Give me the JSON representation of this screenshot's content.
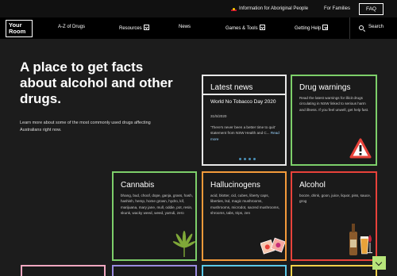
{
  "topbar": {
    "aboriginal_link": "Information for Aboriginal People",
    "families_link": "For Families",
    "faq_label": "FAQ"
  },
  "logo": {
    "line1": "Your",
    "line2": "Room"
  },
  "nav": {
    "az_drugs": "A-Z of Drugs",
    "resources": "Resources",
    "news": "News",
    "games_tools": "Games & Tools",
    "getting_help": "Getting Help",
    "search": "Search"
  },
  "hero": {
    "title": "A place to get facts about alcohol and other drugs.",
    "subtitle": "Learn more about some of the most commonly used drugs affecting Australians right now."
  },
  "cards": {
    "news": {
      "heading": "Latest news",
      "item_title": "World No Tobacco Day 2020",
      "item_date": "31/5/2020",
      "item_body": "'There's never been a better time to quit' statement from NSW Health and C...",
      "read_more": "Read more"
    },
    "warnings": {
      "heading": "Drug warnings",
      "body": "Read the latest warnings for illicit drugs circulating in NSW linked to serious harm and illness. If you feel unwell, get help fast."
    },
    "cannabis": {
      "heading": "Cannabis",
      "body": "bhang, bud, choof, dope, ganja, grass, hash, hashish, hemp, home grown, hydro, kif, marijuana, mary jane, mull, oddie, pot, resin, skunk, wacky weed, weed, yarndi, zero"
    },
    "hallucinogens": {
      "heading": "Hallucinogens",
      "body": "acid, blotter, cid, cubes, liberty caps, liberties, lsd, magic mushrooms, mushrooms, microdot, sacred mushrooms, shrooms, tabs, trips, zen"
    },
    "alcohol": {
      "heading": "Alcohol",
      "body": "booze, drink, goon, juice, liquor, piss, sauce, grog"
    }
  },
  "colors": {
    "green": "#7dcf6a",
    "orange": "#f39a3a",
    "red": "#e8423a",
    "scroll_button": "#b7e57a"
  }
}
